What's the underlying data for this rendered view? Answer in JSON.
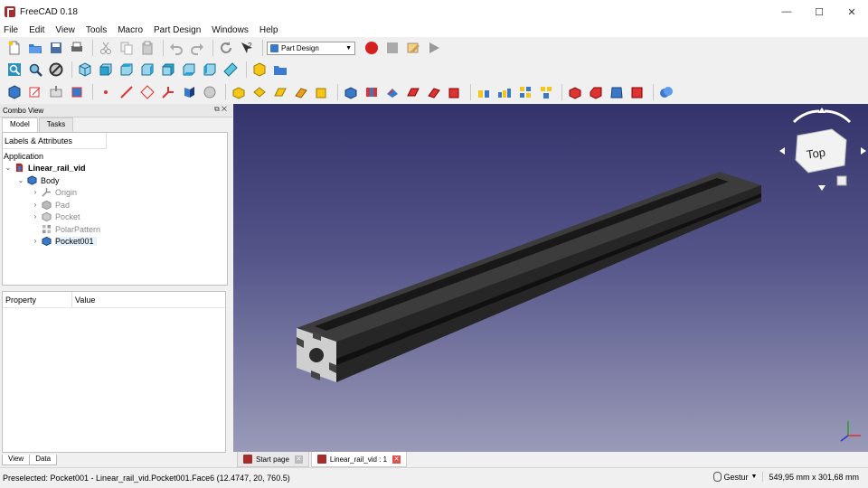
{
  "window": {
    "title": "FreeCAD 0.18",
    "minimize": "—",
    "maximize": "☐",
    "close": "✕"
  },
  "menu": [
    "File",
    "Edit",
    "View",
    "Tools",
    "Macro",
    "Part Design",
    "Windows",
    "Help"
  ],
  "toolbar": {
    "workbench": "Part Design"
  },
  "combo": {
    "title": "Combo View",
    "tabs": [
      "Model",
      "Tasks"
    ],
    "tree_header": "Labels & Attributes",
    "application": "Application",
    "document": "Linear_rail_vid",
    "body": "Body",
    "features": [
      "Origin",
      "Pad",
      "Pocket",
      "PolarPattern",
      "Pocket001"
    ]
  },
  "properties": {
    "col_property": "Property",
    "col_value": "Value",
    "tabs": [
      "View",
      "Data"
    ]
  },
  "navcube": {
    "face": "Top"
  },
  "doc_tabs": [
    "Start page",
    "Linear_rail_vid : 1"
  ],
  "status": {
    "message": "Preselected: Pocket001 - Linear_rail_vid.Pocket001.Face6 (12.4747, 20, 760.5)",
    "nav_style": "Gestur",
    "dimensions": "549,95 mm x 301,68 mm"
  }
}
